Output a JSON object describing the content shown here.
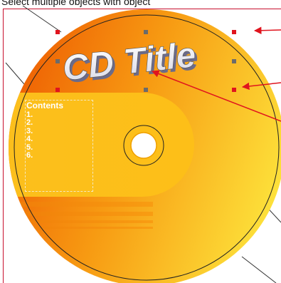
{
  "header": {
    "caption": "Select multiple objects with object"
  },
  "cd": {
    "title": "CD Title",
    "contents_title": "Contents",
    "items": [
      "1.",
      "2.",
      "3.",
      "4.",
      "5.",
      "6."
    ]
  },
  "colors": {
    "frame_red": "#c8102e",
    "handle_red": "#e0141e",
    "handle_gray": "#6b6b6b",
    "disc_orange_dark": "#ee6a05",
    "disc_orange_light": "#fcd32f",
    "band_yellow": "#fdbd1a"
  },
  "icons": [
    "selection-handle",
    "callout-arrow"
  ]
}
